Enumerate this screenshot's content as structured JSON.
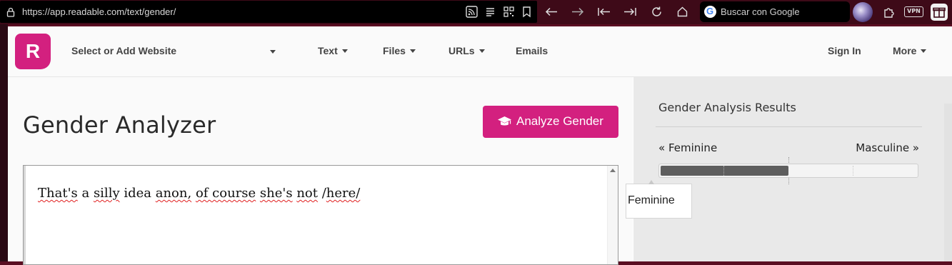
{
  "browser": {
    "url": "https://app.readable.com/text/gender/",
    "search_placeholder": "Buscar con Google",
    "vpn_label": "VPN"
  },
  "nav": {
    "logo_letter": "R",
    "site_select": "Select or Add Website",
    "items": [
      "Text",
      "Files",
      "URLs",
      "Emails"
    ],
    "sign_in": "Sign In",
    "more": "More"
  },
  "main": {
    "title": "Gender Analyzer",
    "analyze_button": "Analyze Gender",
    "text_parts": [
      {
        "text": "That's",
        "misspelled": true
      },
      {
        "text": " a ",
        "misspelled": false
      },
      {
        "text": "silly",
        "misspelled": true
      },
      {
        "text": " idea ",
        "misspelled": false
      },
      {
        "text": "anon,",
        "misspelled": true
      },
      {
        "text": " ",
        "misspelled": false
      },
      {
        "text": "of course",
        "misspelled": true
      },
      {
        "text": " ",
        "misspelled": false
      },
      {
        "text": "she's",
        "misspelled": true
      },
      {
        "text": " ",
        "misspelled": false
      },
      {
        "text": "not",
        "misspelled": true
      },
      {
        "text": " /",
        "misspelled": false
      },
      {
        "text": "here/",
        "misspelled": true
      }
    ]
  },
  "results": {
    "title": "Gender Analysis Results",
    "feminine_label": "« Feminine",
    "masculine_label": "Masculine »",
    "score_fraction": 0.5,
    "tooltip": "Feminine"
  },
  "colors": {
    "accent": "#d3207f",
    "bar_fill": "#5e5e5e"
  }
}
